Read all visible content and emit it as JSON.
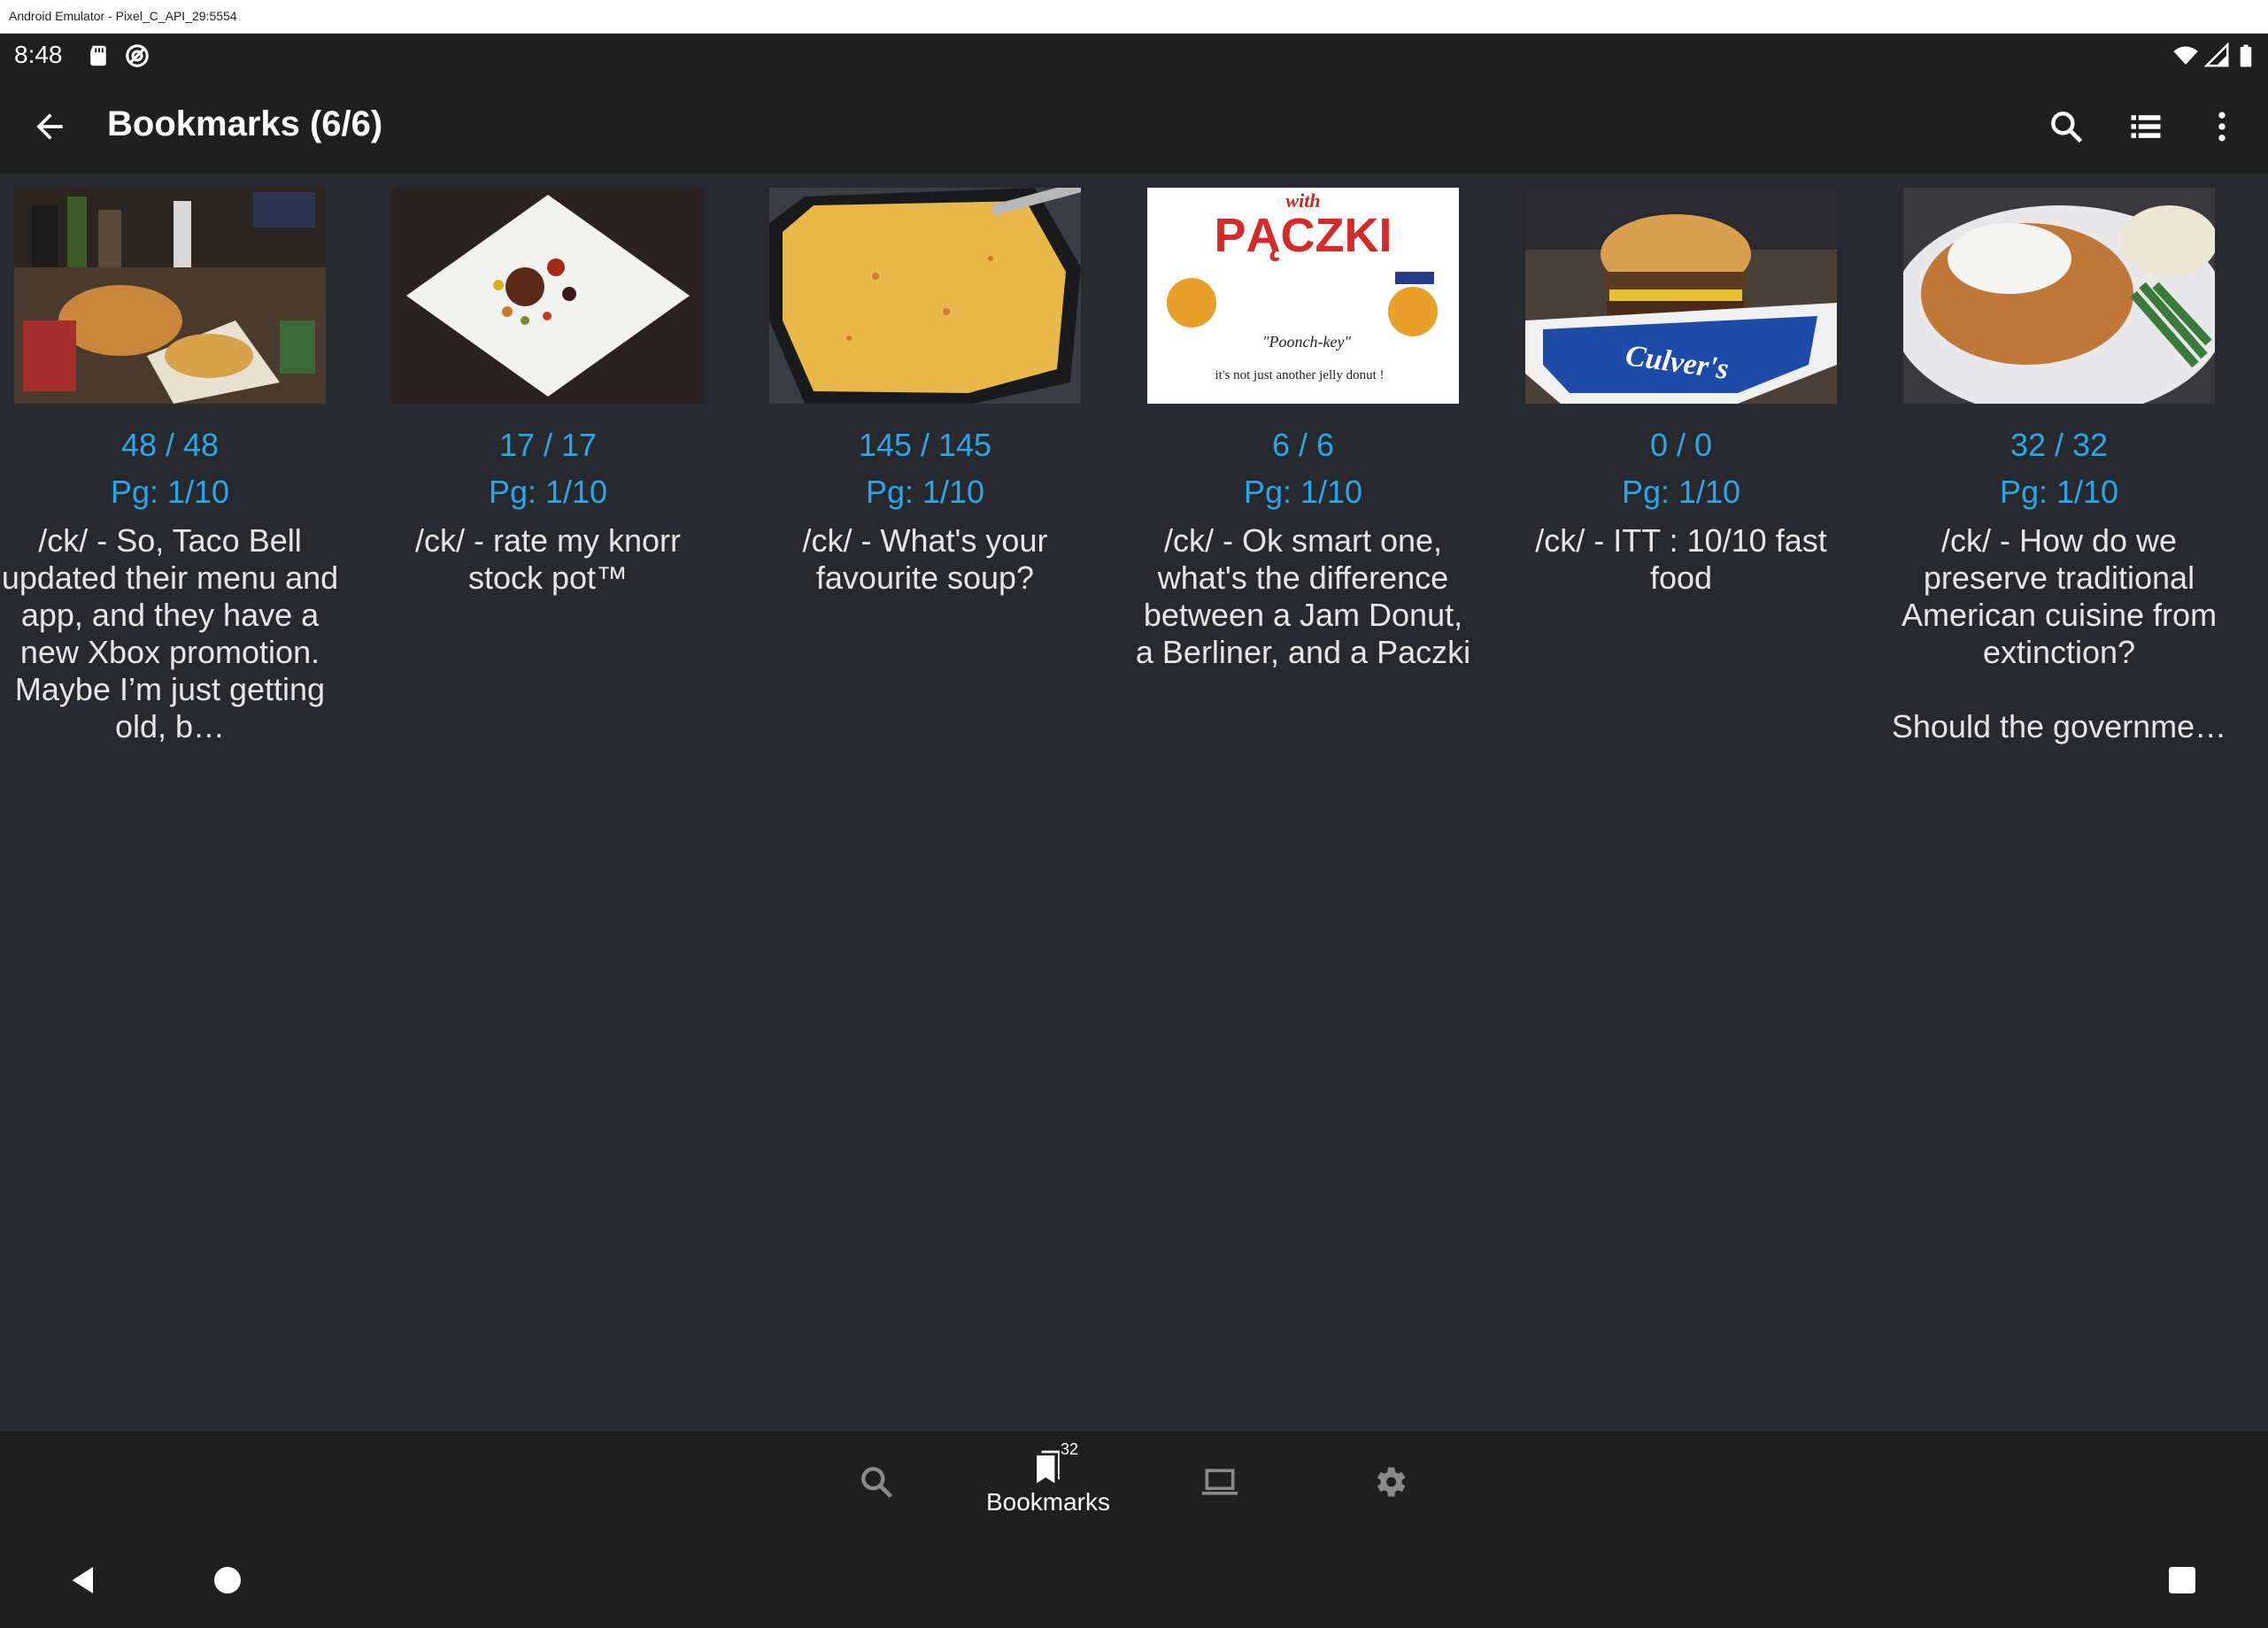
{
  "window": {
    "title": "Android Emulator - Pixel_C_API_29:5554"
  },
  "status_bar": {
    "time": "8:48"
  },
  "toolbar": {
    "title": "Bookmarks (6/6)"
  },
  "bookmarks": [
    {
      "replies": "48 / 48",
      "page": "Pg: 1/10",
      "subject": "/ck/ - So, Taco Bell updated their menu and app, and they have a new Xbox promotion. Maybe I’m just getting old, b…"
    },
    {
      "replies": "17 / 17",
      "page": "Pg: 1/10",
      "subject": "/ck/ - rate my knorr stock pot™"
    },
    {
      "replies": "145 / 145",
      "page": "Pg: 1/10",
      "subject": "/ck/ - What's your favourite soup?"
    },
    {
      "replies": "6 / 6",
      "page": "Pg: 1/10",
      "subject": "/ck/ - Ok smart one, what's the difference between a Jam Donut, a Berliner, and a Paczki",
      "thumb_text": {
        "top": "with",
        "headline": "PĄCZKI",
        "quote": "\"Poonch-key\"",
        "tagline": "it's not just another jelly donut !"
      }
    },
    {
      "replies": "0 / 0",
      "page": "Pg: 1/10",
      "subject": "/ck/ - ITT : 10/10 fast food",
      "thumb_text": {
        "brand": "Culver's"
      }
    },
    {
      "replies": "32 / 32",
      "page": "Pg: 1/10",
      "subject": "/ck/ - How do we preserve traditional American cuisine from extinction?\n\nShould the governme…"
    }
  ],
  "bottom_nav": {
    "items": [
      {
        "icon": "search-icon"
      },
      {
        "icon": "bookmarks-icon",
        "label": "Bookmarks",
        "badge": "32"
      },
      {
        "icon": "laptop-icon"
      },
      {
        "icon": "settings-icon"
      }
    ]
  },
  "colors": {
    "accent": "#29a7e6",
    "background": "#28292f",
    "bar": "#1f1f1f"
  }
}
